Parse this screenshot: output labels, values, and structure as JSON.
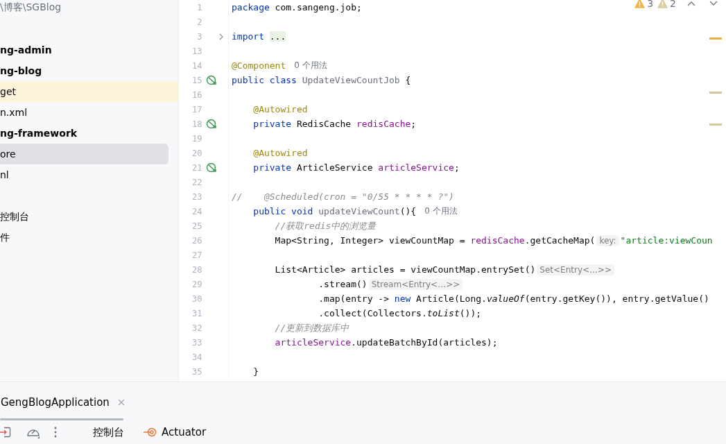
{
  "project_tree": {
    "path": "\\博客\\SGBlog",
    "items": [
      {
        "label": "ng-admin",
        "kind": "module",
        "selected": false
      },
      {
        "label": "ng-blog",
        "kind": "module",
        "selected": false
      },
      {
        "label": "get",
        "kind": "excluded",
        "selected": false
      },
      {
        "label": "n.xml",
        "kind": "file",
        "selected": false
      },
      {
        "label": "ng-framework",
        "kind": "module",
        "selected": false
      },
      {
        "label": "ore",
        "kind": "file",
        "selected": true
      },
      {
        "label": "nl",
        "kind": "file",
        "selected": false
      },
      {
        "label": "控制台",
        "kind": "gap",
        "selected": false
      },
      {
        "label": "件",
        "kind": "file",
        "selected": false
      }
    ]
  },
  "editor": {
    "inspections": [
      {
        "kind": "warning",
        "count": "3"
      },
      {
        "kind": "weak_warning",
        "count": "2"
      }
    ],
    "lines": [
      {
        "number": "1",
        "kind": "plain",
        "segments": [
          {
            "kind": "kw",
            "text": "package"
          },
          {
            "kind": "plain",
            "text": " com.sangeng.job;"
          }
        ]
      },
      {
        "number": "2",
        "kind": "plain"
      },
      {
        "number": "3",
        "kind": "fold",
        "segments": [
          {
            "kind": "kw",
            "text": "import "
          },
          {
            "kind": "folded",
            "text": "..."
          }
        ]
      },
      {
        "number": "13",
        "kind": "plain"
      },
      {
        "number": "14",
        "kind": "plain",
        "segments": [
          {
            "kind": "ann",
            "text": "@Component"
          },
          {
            "kind": "usages",
            "text": "0 个用法"
          }
        ]
      },
      {
        "number": "15",
        "kind": "bean",
        "segments": [
          {
            "kind": "kw",
            "text": "public class "
          },
          {
            "kind": "unused",
            "text": "UpdateViewCountJob"
          },
          {
            "kind": "plain",
            "text": " {"
          }
        ]
      },
      {
        "number": "16",
        "kind": "plain"
      },
      {
        "number": "17",
        "kind": "plain",
        "segments": [
          {
            "kind": "ann",
            "text": "    @Autowired"
          }
        ]
      },
      {
        "number": "18",
        "kind": "bean",
        "segments": [
          {
            "kind": "kw",
            "text": "    private"
          },
          {
            "kind": "plain",
            "text": " RedisCache "
          },
          {
            "kind": "field",
            "text": "redisCache"
          },
          {
            "kind": "plain",
            "text": ";"
          }
        ]
      },
      {
        "number": "19",
        "kind": "plain"
      },
      {
        "number": "20",
        "kind": "plain",
        "segments": [
          {
            "kind": "ann",
            "text": "    @Autowired"
          }
        ]
      },
      {
        "number": "21",
        "kind": "bean",
        "segments": [
          {
            "kind": "kw",
            "text": "    private"
          },
          {
            "kind": "plain",
            "text": " ArticleService "
          },
          {
            "kind": "field",
            "text": "articleService"
          },
          {
            "kind": "plain",
            "text": ";"
          }
        ]
      },
      {
        "number": "22",
        "kind": "plain"
      },
      {
        "number": "23",
        "kind": "plain",
        "segments": [
          {
            "kind": "comment",
            "text": "//    @Scheduled(cron = \"0/55 * * * * ?\")"
          }
        ]
      },
      {
        "number": "24",
        "kind": "plain",
        "segments": [
          {
            "kind": "kw",
            "text": "    public void "
          },
          {
            "kind": "unused",
            "text": "updateViewCount"
          },
          {
            "kind": "plain",
            "text": "(){"
          },
          {
            "kind": "usages",
            "text": "0 个用法"
          }
        ]
      },
      {
        "number": "25",
        "kind": "plain",
        "segments": [
          {
            "kind": "comment",
            "text": "        //获取redis中的浏览量"
          }
        ]
      },
      {
        "number": "26",
        "kind": "plain",
        "segments": [
          {
            "kind": "plain",
            "text": "        Map<String, Integer> viewCountMap = "
          },
          {
            "kind": "field",
            "text": "redisCache"
          },
          {
            "kind": "plain",
            "text": ".getCacheMap("
          },
          {
            "kind": "hint",
            "text": "key:"
          },
          {
            "kind": "string",
            "text": "\"article:viewCoun"
          }
        ]
      },
      {
        "number": "27",
        "kind": "plain"
      },
      {
        "number": "28",
        "kind": "plain",
        "segments": [
          {
            "kind": "plain",
            "text": "        List<Article> articles = viewCountMap.entrySet()"
          },
          {
            "kind": "hint",
            "text": "Set<Entry<…>>"
          }
        ]
      },
      {
        "number": "29",
        "kind": "plain",
        "segments": [
          {
            "kind": "plain",
            "text": "                .stream()"
          },
          {
            "kind": "hint",
            "text": "Stream<Entry<…>>"
          }
        ]
      },
      {
        "number": "30",
        "kind": "plain",
        "segments": [
          {
            "kind": "plain",
            "text": "                .map(entry -> "
          },
          {
            "kind": "kw",
            "text": "new"
          },
          {
            "kind": "plain",
            "text": " Article(Long."
          },
          {
            "kind": "static",
            "text": "valueOf"
          },
          {
            "kind": "plain",
            "text": "(entry.getKey()), entry.getValue()"
          }
        ]
      },
      {
        "number": "31",
        "kind": "plain",
        "segments": [
          {
            "kind": "plain",
            "text": "                .collect(Collectors."
          },
          {
            "kind": "static",
            "text": "toList"
          },
          {
            "kind": "plain",
            "text": "());"
          }
        ]
      },
      {
        "number": "32",
        "kind": "plain",
        "segments": [
          {
            "kind": "comment",
            "text": "        //更新到数据库中"
          }
        ]
      },
      {
        "number": "33",
        "kind": "plain",
        "segments": [
          {
            "kind": "field",
            "text": "        articleService"
          },
          {
            "kind": "plain",
            "text": ".updateBatchById(articles);"
          }
        ]
      },
      {
        "number": "34",
        "kind": "plain"
      },
      {
        "number": "35",
        "kind": "plain",
        "segments": [
          {
            "kind": "plain",
            "text": "    }"
          }
        ]
      }
    ]
  },
  "run_panel": {
    "tab": {
      "label": "GengBlogApplication"
    },
    "tool_tabs": [
      {
        "kind": "console",
        "label": "控制台"
      },
      {
        "kind": "actuator",
        "label": "Actuator"
      }
    ]
  }
}
